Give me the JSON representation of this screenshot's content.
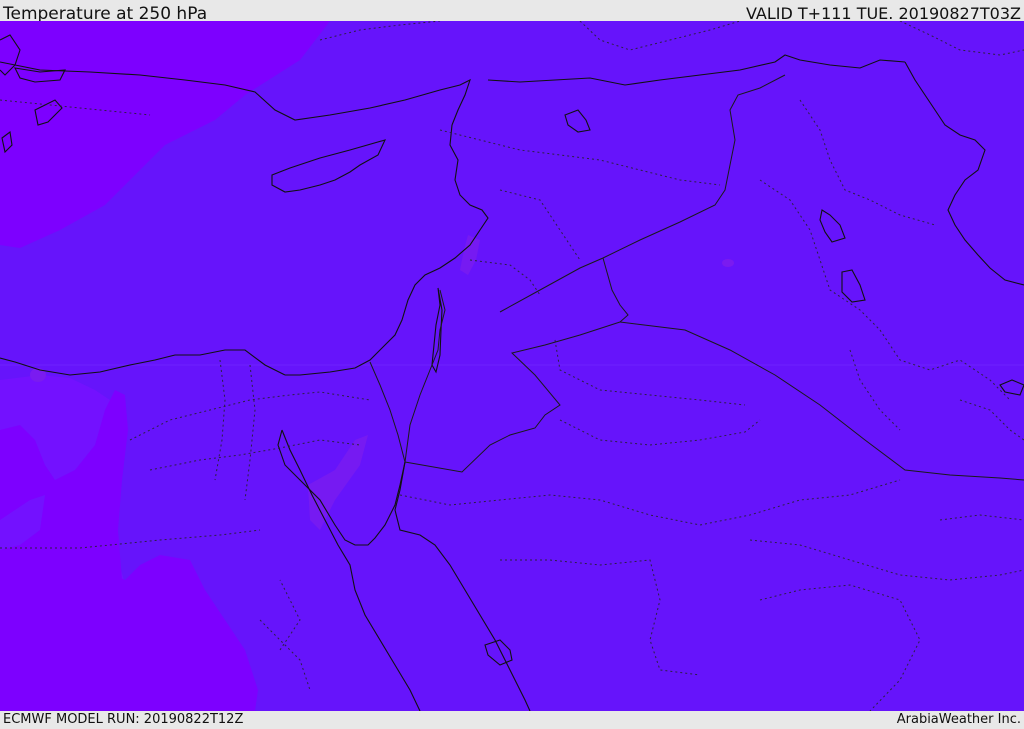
{
  "header": {
    "title": "Temperature at 250 hPa",
    "valid_time": "VALID T+111 TUE. 20190827T03Z"
  },
  "footer": {
    "model_run": "ECMWF MODEL RUN: 20190822T12Z",
    "credit": "ArabiaWeather Inc."
  },
  "map": {
    "colors": {
      "main_fill": "#6614fb",
      "cold_fill": "#7d00ff",
      "mid_fill": "#7311ff",
      "warm_spot": "#7a1bf0",
      "coast_line": "#111111",
      "border_line": "#222222"
    }
  }
}
